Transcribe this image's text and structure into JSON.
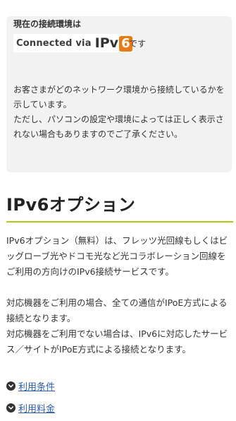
{
  "status_box": {
    "heading": "現在の接続環境は",
    "badge": {
      "connected_text": "Connected via",
      "ipv_text": "IPv",
      "six_text": "6"
    },
    "badge_suffix": "です",
    "description": [
      "お客さまがどのネットワーク環境から接続しているかを示しています。",
      "ただし、パソコンの設定や環境によっては正しく表示されない場合もありますのでご了承ください。"
    ]
  },
  "section": {
    "title": "IPv6オプション",
    "rule_color": "#b5c81a",
    "paragraphs": [
      "IPv6オプション（無料）は、フレッツ光回線もしくはビッグローブ光やドコモ光など光コラボレーション回線をご利用の方向けのIPv6接続サービスです。",
      "対応機器をご利用の場合、全ての通信がIPoE方式による接続となります。",
      "対応機器をご利用でない場合は、IPv6に対応したサービス／サイトがIPoE方式による接続となります。"
    ]
  },
  "links": [
    {
      "label": "利用条件",
      "icon": "chevron-down-circle-icon"
    },
    {
      "label": "利用料金",
      "icon": "chevron-down-circle-icon"
    }
  ],
  "colors": {
    "link": "#2b5dab",
    "badge_orange": "#e97b16",
    "box_background": "#f2f2f2"
  }
}
